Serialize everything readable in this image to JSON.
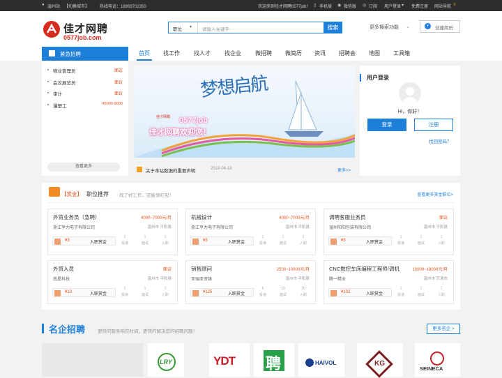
{
  "topbar": {
    "city": "温州站",
    "switch_city": "【切换城市】",
    "hotline": "热线电话：18969702350",
    "welcome": "欢迎来到佳才网聘0577job！",
    "mobile": "手机版",
    "wechat": "微信版",
    "subscribe": "订阅",
    "user_login": "用户登录",
    "free_register": "免费注册",
    "site_nav": "网站导航"
  },
  "header": {
    "logo_text": "佳才网聘",
    "logo_domain": "0577job.com",
    "search_type": "职位",
    "search_placeholder": "请输入关键字",
    "search_button": "搜索",
    "more_search": "更多搜索功能",
    "create_resume": "创建简历"
  },
  "nav": {
    "urgent": "紧急招聘",
    "items": [
      "首页",
      "找工作",
      "找人才",
      "找企业",
      "微招聘",
      "微简历",
      "资讯",
      "招聘会",
      "地图",
      "工具箱"
    ]
  },
  "urgent_jobs": [
    {
      "title": "物业管理员",
      "salary": "面议"
    },
    {
      "title": "会议展览员",
      "salary": "面议"
    },
    {
      "title": "审计",
      "salary": "面议"
    },
    {
      "title": "漫塑工",
      "salary": "¥6000-8000"
    }
  ],
  "urgent_more": "查看更多",
  "banner": {
    "brand_small": "佳才网聘",
    "brand": "0577job",
    "slogan": "佳才网聘欢迎您！",
    "art_text": "梦想启航"
  },
  "notice": {
    "text": "关于本站数据的重要声明",
    "date": "2019-04-18",
    "more": "更多>>"
  },
  "login": {
    "title": "用户登录",
    "greeting": "Hi，你好！",
    "login_btn": "登录",
    "register_btn": "注册",
    "forgot": "找回密码？"
  },
  "recommend": {
    "badge": "【赏金】",
    "title": "职位推荐",
    "subtitle": "找了好工作，还能领红包！",
    "more": "查看更多赏金职位>"
  },
  "jobs": [
    {
      "title": "外贸业务员（急聘）",
      "salary": "4000~7000元/月",
      "company": "浙江亨力电子有限公司",
      "location": "温州市 平阳县",
      "bounty": "¥3",
      "bounty_label": "入职赏金",
      "stats": [
        {
          "n": "1",
          "t": "投递"
        },
        {
          "n": "1",
          "t": "面试"
        },
        {
          "n": "1",
          "t": "入职"
        }
      ]
    },
    {
      "title": "机械设计",
      "salary": "4000~7000元/月",
      "company": "浙江亨力电子有限公司",
      "location": "温州市 平阳县",
      "bounty": "¥3",
      "bounty_label": "入职赏金",
      "stats": [
        {
          "n": "1",
          "t": "投递"
        },
        {
          "n": "1",
          "t": "面试"
        },
        {
          "n": "1",
          "t": "入职"
        }
      ]
    },
    {
      "title": "调聘客服业务员",
      "salary": "面议",
      "company": "温州阳阳包装有限公司",
      "location": "温州市 平阳县",
      "bounty": "¥3",
      "bounty_label": "入职赏金",
      "stats": [
        {
          "n": "1",
          "t": "投递"
        },
        {
          "n": "1",
          "t": "面试"
        },
        {
          "n": "1",
          "t": "入职"
        }
      ]
    },
    {
      "title": "外贸人员",
      "salary": "面议",
      "company": "南星科技",
      "location": "温州市 平阳县",
      "bounty": "¥10",
      "bounty_label": "入职赏金",
      "stats": [
        {
          "n": "1",
          "t": "投递"
        },
        {
          "n": "1",
          "t": "面试"
        },
        {
          "n": "1",
          "t": "入职"
        }
      ]
    },
    {
      "title": "销售顾问",
      "salary": "2500~10000元/月",
      "company": "亚瑞亚资铸",
      "location": "温州市 平阳县",
      "bounty": "¥125",
      "bounty_label": "入职赏金",
      "stats": [
        {
          "n": "5",
          "t": "投递"
        },
        {
          "n": "10",
          "t": "面试"
        },
        {
          "n": "10",
          "t": "入职"
        }
      ]
    },
    {
      "title": "CNC数控车床编程工程师/调机",
      "salary": "10000~18000元/月",
      "company": "腾一精业",
      "location": "温州市 乐清市",
      "bounty": "¥102",
      "bounty_label": "入职赏金",
      "stats": [
        {
          "n": "1",
          "t": "投递"
        },
        {
          "n": "1",
          "t": "面试"
        },
        {
          "n": "1",
          "t": "入职"
        }
      ]
    }
  ],
  "famous": {
    "title": "名企招聘",
    "subtitle": "更快的服务响应时间，更快的解决您的招聘问题！",
    "more": "更多名企 >",
    "logos": [
      "LRY",
      "YDT",
      "聘",
      "HAIVOL",
      "KG",
      "SEINECA"
    ]
  },
  "colors": {
    "accent": "#1e7fd9",
    "orange": "#e8521b",
    "topbar": "#2d2d2d"
  }
}
